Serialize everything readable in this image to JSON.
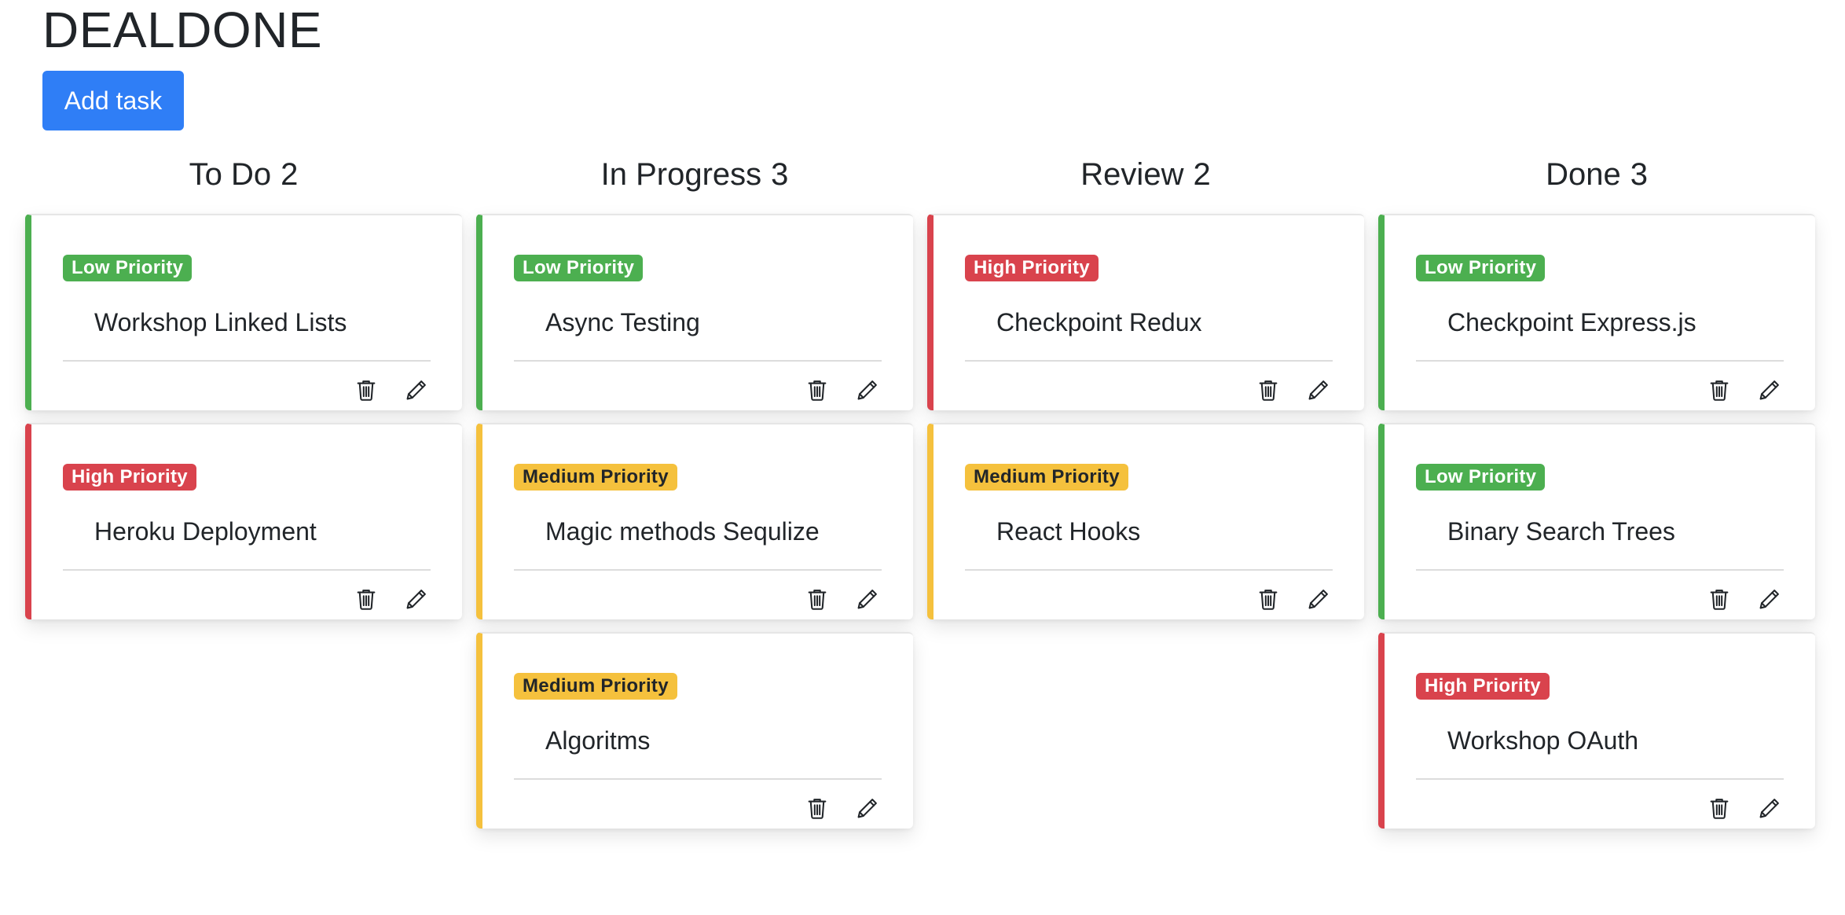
{
  "app": {
    "title": "DEALDONE",
    "add_task_label": "Add task"
  },
  "columns": [
    {
      "name": "To Do",
      "count": "2",
      "tasks": [
        {
          "priority": "low",
          "priority_label": "Low Priority",
          "title": "Workshop Linked Lists"
        },
        {
          "priority": "high",
          "priority_label": "High Priority",
          "title": "Heroku Deployment"
        }
      ]
    },
    {
      "name": "In Progress",
      "count": "3",
      "tasks": [
        {
          "priority": "low",
          "priority_label": "Low Priority",
          "title": "Async Testing"
        },
        {
          "priority": "medium",
          "priority_label": "Medium Priority",
          "title": "Magic methods Sequlize"
        },
        {
          "priority": "medium",
          "priority_label": "Medium Priority",
          "title": "Algoritms"
        }
      ]
    },
    {
      "name": "Review",
      "count": "2",
      "tasks": [
        {
          "priority": "high",
          "priority_label": "High Priority",
          "title": "Checkpoint Redux"
        },
        {
          "priority": "medium",
          "priority_label": "Medium Priority",
          "title": "React Hooks"
        }
      ]
    },
    {
      "name": "Done",
      "count": "3",
      "tasks": [
        {
          "priority": "low",
          "priority_label": "Low Priority",
          "title": "Checkpoint Express.js"
        },
        {
          "priority": "low",
          "priority_label": "Low Priority",
          "title": "Binary Search Trees"
        },
        {
          "priority": "high",
          "priority_label": "High Priority",
          "title": "Workshop OAuth"
        }
      ]
    }
  ],
  "icons": {
    "delete": "trash-icon",
    "edit": "pencil-icon"
  },
  "colors": {
    "accent": "#2f7ef6",
    "low": "#4caf50",
    "high": "#d9434d",
    "medium": "#f5c13d"
  }
}
